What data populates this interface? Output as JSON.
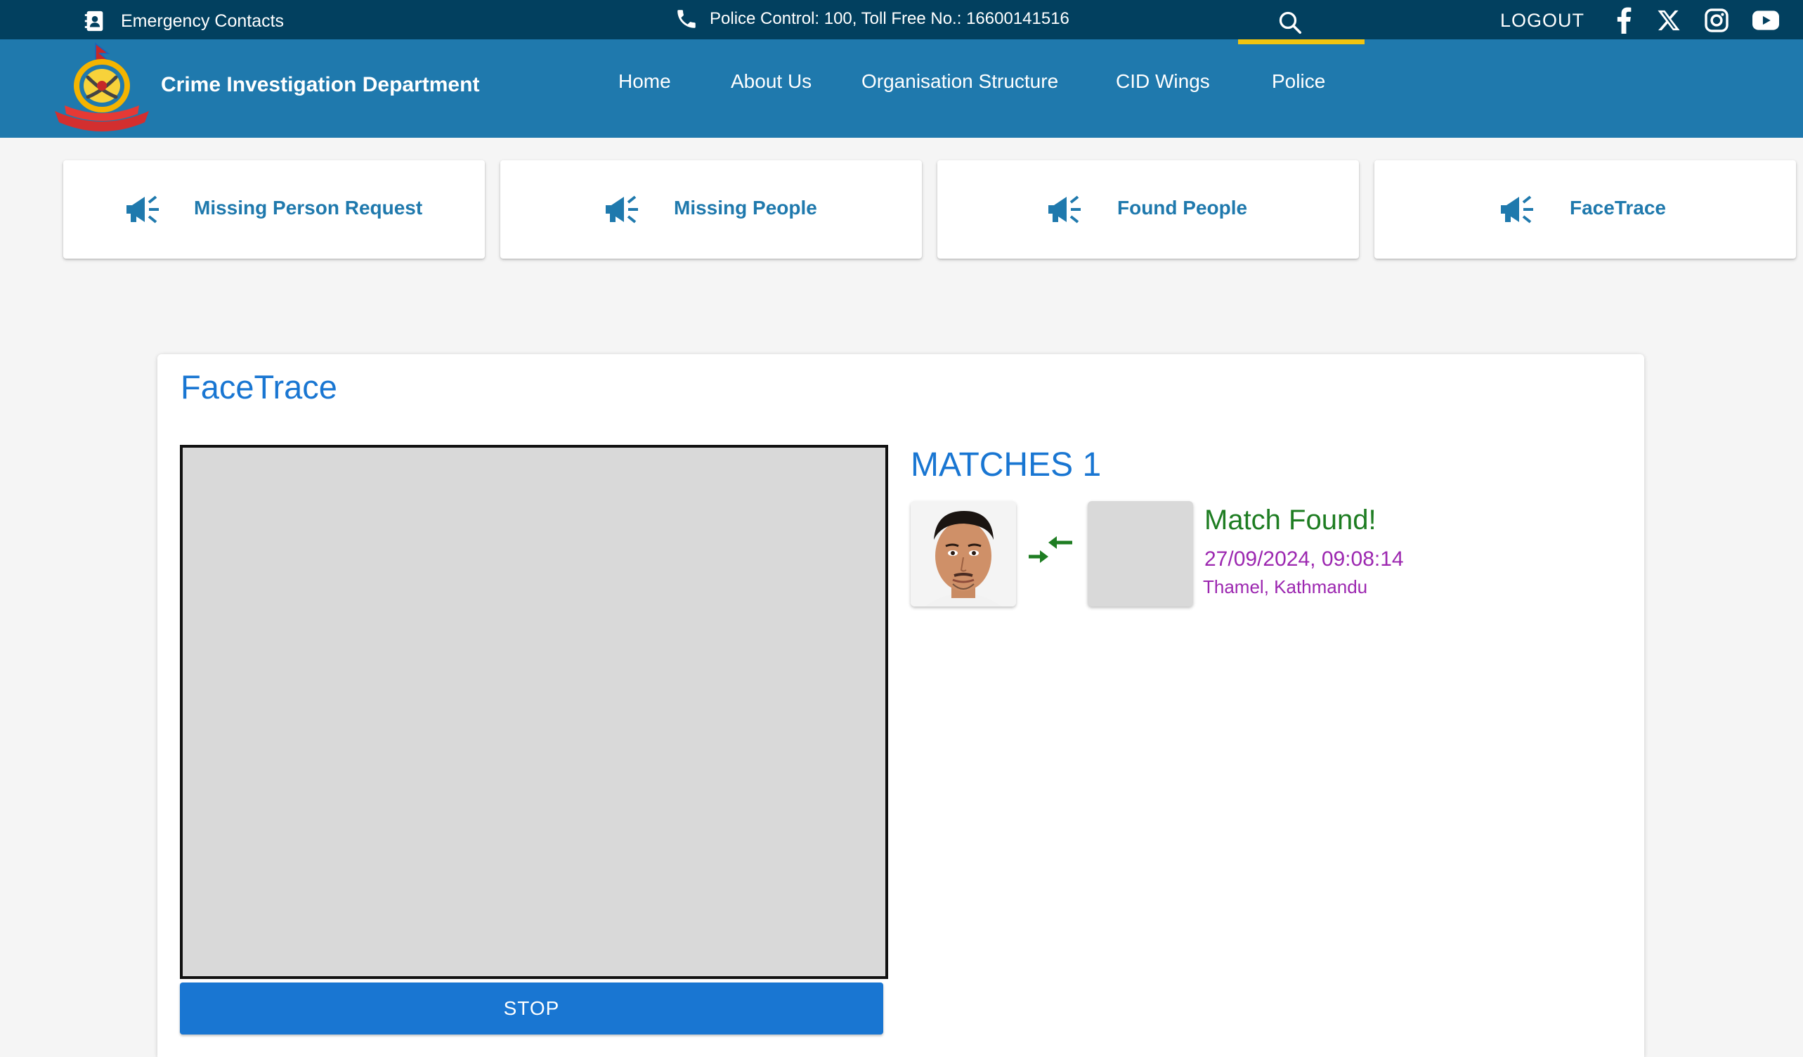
{
  "topbar": {
    "emergency_label": "Emergency Contacts",
    "contact_text": "Police Control: 100, Toll Free No.: 16600141516",
    "logout_label": "LOGOUT",
    "social_icons": [
      "facebook-icon",
      "x-icon",
      "instagram-icon",
      "youtube-icon"
    ]
  },
  "header": {
    "brand": "Crime Investigation Department",
    "nav": [
      "Home",
      "About Us",
      "Organisation Structure",
      "CID Wings",
      "Police"
    ],
    "active_nav": "Police"
  },
  "quick_links": [
    {
      "label": "Missing Person Request",
      "icon": "megaphone-icon"
    },
    {
      "label": "Missing People",
      "icon": "megaphone-icon"
    },
    {
      "label": "Found People",
      "icon": "megaphone-icon"
    },
    {
      "label": "FaceTrace",
      "icon": "megaphone-icon"
    }
  ],
  "facetrace": {
    "title": "FaceTrace",
    "stop_label": "STOP",
    "matches_label": "MATCHES 1",
    "match": {
      "status": "Match Found!",
      "datetime": "27/09/2024, 09:08:14",
      "location": "Thamel, Kathmandu"
    }
  },
  "colors": {
    "topbar": "#02405f",
    "header": "#1f79ad",
    "accent": "#1976d2",
    "active_underline": "#f1c40f",
    "match_found": "#1e7d22",
    "match_meta": "#9c27b0"
  }
}
